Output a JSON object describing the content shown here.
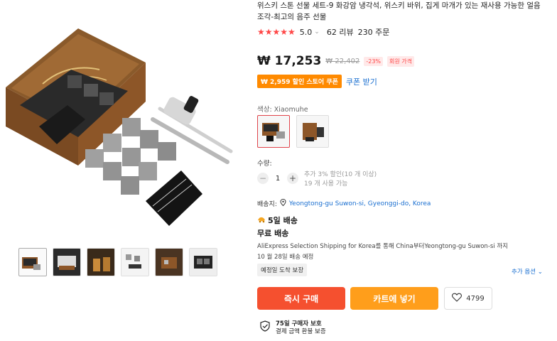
{
  "product": {
    "title": "위스키 스톤 선물 세트-9 화강암 냉각석, 위스키 바위, 집게 마개가 있는 재사용 가능한 얼음 조각-최고의 음주 선물",
    "rating": "5.0",
    "reviews": "62 리뷰",
    "orders": "230 주문"
  },
  "price": {
    "current": "₩ 17,253",
    "original": "₩ 22,402",
    "discount": "-23%",
    "member_label": "회원 가격"
  },
  "coupon": {
    "label": "₩ 2,959 할인 스토어 쿠폰",
    "link": "쿠폰 받기"
  },
  "color": {
    "label": "색상: Xiaomuhe",
    "options": [
      "option-1",
      "option-2"
    ]
  },
  "quantity": {
    "label": "수량:",
    "minus": "−",
    "plus": "+",
    "value": "1",
    "note1": "추가 3% 할인(10 개 이상)",
    "note2": "19 개 사용 가능"
  },
  "shipping": {
    "to_label": "배송지:",
    "address": "Yeongtong-gu Suwon-si, Gyeonggi-do, Korea",
    "days": "5일 배송",
    "free": "무료 배송",
    "desc": "AliExpress Selection Shipping for Korea를 통해 China부터Yeongtong-gu Suwon-si 까지",
    "date": "10 월 28일 배송 예정",
    "guarantee": "예정일 도착 보장",
    "more": "추가 옵션"
  },
  "actions": {
    "buy_now": "즉시 구매",
    "add_cart": "카트에 넣기",
    "wish_count": "4799"
  },
  "protection": {
    "line1": "75일 구매자 보호",
    "line2": "결제 금액 환불 보증"
  },
  "colors": {
    "accent_red": "#f5502f",
    "accent_orange": "#ff9e1b",
    "star": "#ff4747",
    "link_blue": "#1a6fd0"
  }
}
